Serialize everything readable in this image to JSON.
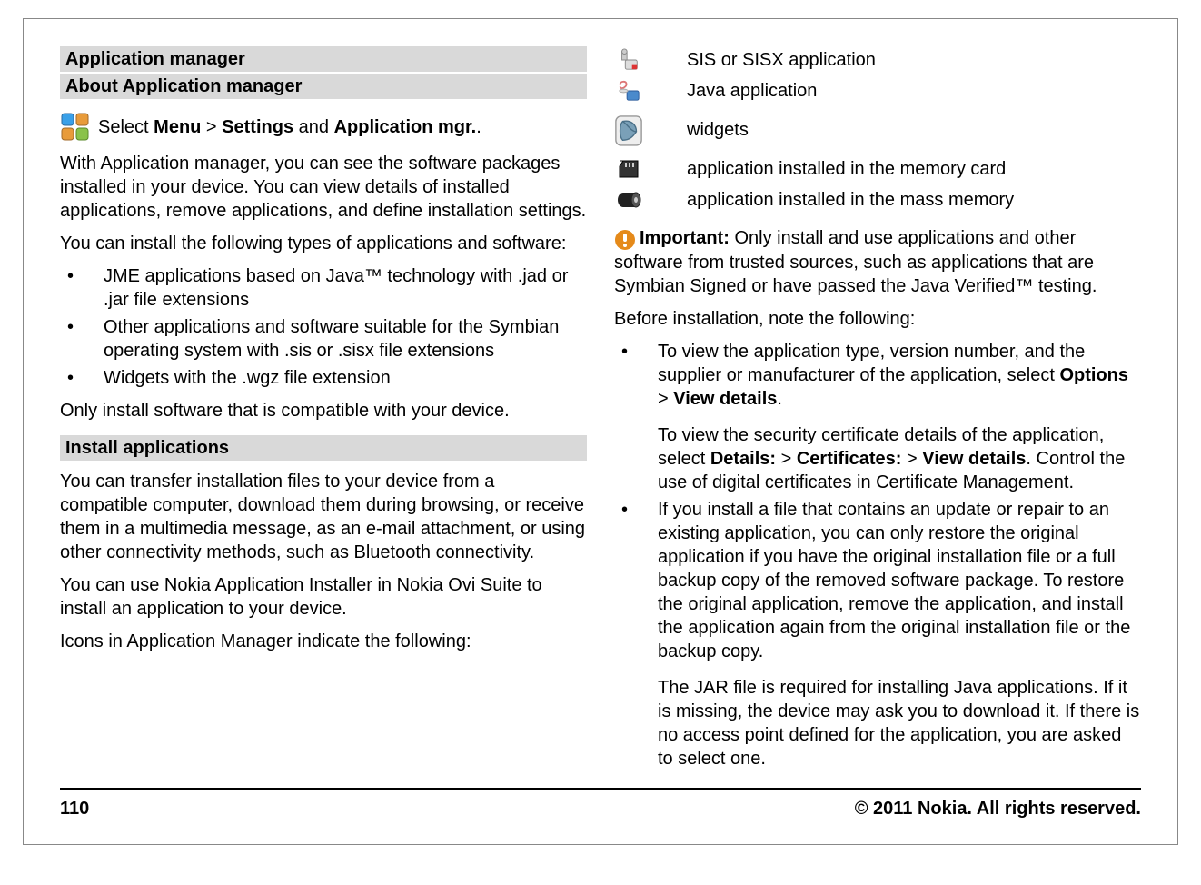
{
  "left": {
    "heading1": "Application manager",
    "heading2": "About Application manager",
    "nav_pre": "Select ",
    "nav_menu": "Menu",
    "nav_gt1": " > ",
    "nav_settings": "Settings",
    "nav_and": " and ",
    "nav_appmgr": "Application mgr.",
    "nav_dot": ".",
    "p1": "With Application manager, you can see the software packages installed in your device. You can view details of installed applications, remove applications, and define installation settings.",
    "p2": "You can install the following types of applications and software:",
    "bullets": [
      "JME applications based on Java™ technology with .jad or .jar file extensions",
      "Other applications and software suitable for the Symbian operating system with .sis or .sisx file extensions",
      "Widgets with the .wgz file extension"
    ],
    "p3": "Only install software that is compatible with your device.",
    "heading3": "Install applications",
    "p4": "You can transfer installation files to your device from a compatible computer, download them during browsing, or receive them in a multimedia message, as an e-mail attachment, or using other connectivity methods, such as Bluetooth connectivity.",
    "p5": "You can use Nokia Application Installer in Nokia Ovi Suite to install an application to your device.",
    "p6": "Icons in Application Manager indicate the following:"
  },
  "right": {
    "icons": [
      {
        "name": "sis-icon",
        "label": "SIS or SISX application"
      },
      {
        "name": "java-icon",
        "label": "Java application"
      },
      {
        "name": "widgets-icon",
        "label": "widgets"
      },
      {
        "name": "memory-card-icon",
        "label": "application installed in the memory card"
      },
      {
        "name": "mass-memory-icon",
        "label": "application installed in the mass memory"
      }
    ],
    "important_label": "Important:",
    "important_text": " Only install and use applications and other software from trusted sources, such as applications that are Symbian Signed or have passed the Java Verified™ testing.",
    "p_before": "Before installation, note the following:",
    "b1_pre": "To view the application type, version number, and the supplier or manufacturer of the application, select ",
    "b1_options": "Options",
    "b1_gt": " > ",
    "b1_view": "View details",
    "b1_dot": ".",
    "b1_p2_pre": "To view the security certificate details of the application, select ",
    "b1_details": "Details:",
    "b1_gt2": " > ",
    "b1_cert": "Certificates:",
    "b1_gt3": " > ",
    "b1_view2": "View details",
    "b1_p2_post": ". Control the use of digital certificates in Certificate Management.",
    "b2": "If you install a file that contains an update or repair to an existing application, you can only restore the original application if you have the original installation file or a full backup copy of the removed software package. To restore the original application, remove the application, and install the application again from the original installation file or the backup copy.",
    "b2_p2": "The JAR file is required for installing Java applications. If it is missing, the device may ask you to download it. If there is no access point defined for the application, you are asked to select one."
  },
  "footer": {
    "page": "110",
    "copyright": "© 2011 Nokia. All rights reserved."
  }
}
